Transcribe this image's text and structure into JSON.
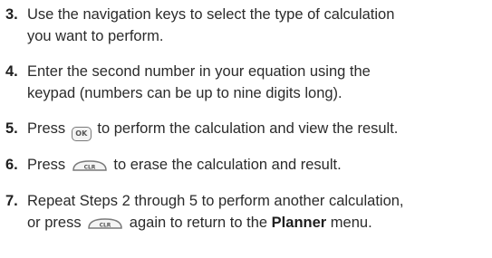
{
  "steps": [
    {
      "number": "3.",
      "line1": "Use the navigation keys to select the type of calculation",
      "line2": "you want to perform."
    },
    {
      "number": "4.",
      "line1": "Enter the second number in your equation using the",
      "line2": "keypad (numbers can be up to nine digits long)."
    },
    {
      "number": "5.",
      "before": "Press",
      "key": "OK",
      "after": "to perform the calculation and view the result."
    },
    {
      "number": "6.",
      "before": "Press",
      "key": "CLR",
      "after": "to erase the calculation and result."
    },
    {
      "number": "7.",
      "line1": "Repeat Steps 2 through 5 to perform another calculation,",
      "line2_before": "or press",
      "line2_key": "CLR",
      "line2_middle": "again to return to the",
      "line2_bold": "Planner",
      "line2_after": "menu."
    }
  ]
}
